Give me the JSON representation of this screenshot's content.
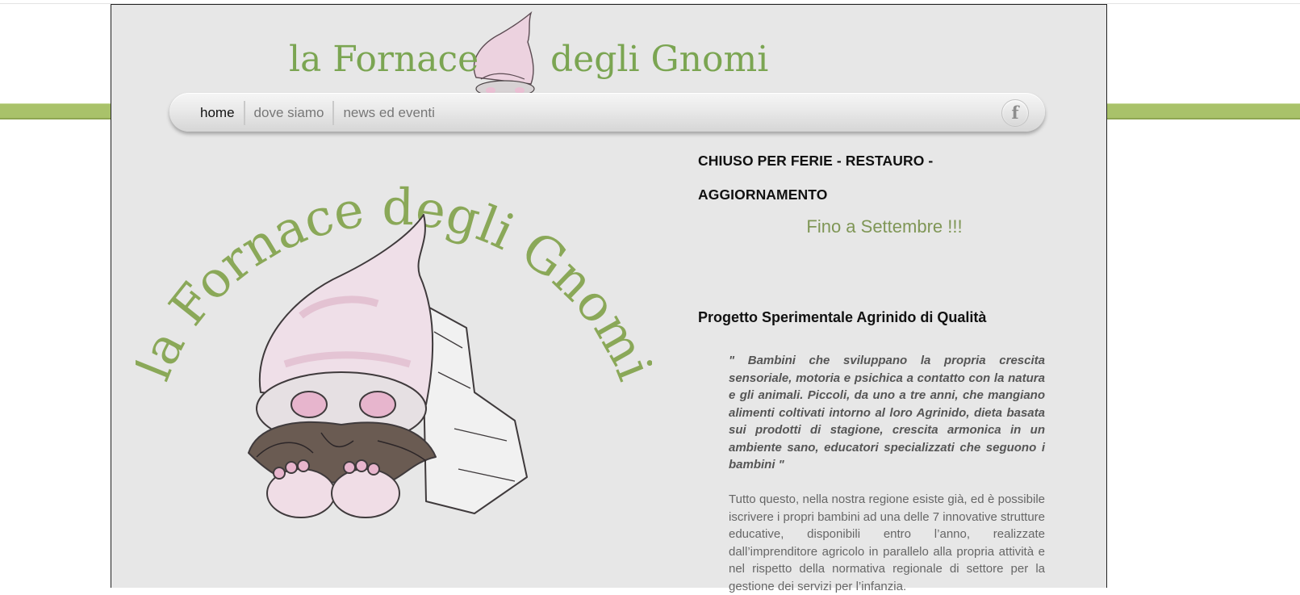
{
  "site": {
    "logo_left": "la Fornace",
    "logo_right": "degli Gnomi",
    "art_text": "la Fornace degli Gnomi"
  },
  "nav": {
    "items": [
      {
        "label": "home"
      },
      {
        "label": "dove siamo"
      },
      {
        "label": "news ed eventi"
      }
    ],
    "social_glyph": "f",
    "social_icon": "facebook-icon"
  },
  "notice": {
    "title_line1": "CHIUSO PER FERIE - RESTAURO -",
    "title_line2": "AGGIORNAMENTO",
    "subtitle": "Fino a Settembre !!!"
  },
  "project": {
    "title": "Progetto Sperimentale Agrinido di Qualità",
    "quote": "\" Bambini che sviluppano la propria crescita sensoriale, motoria e psichica a contatto con la natura e gli animali. Piccoli, da uno a tre anni, che mangiano alimenti coltivati intorno al loro Agrinido, dieta basata sui prodotti di stagione, crescita armonica in un ambiente sano, educatori specializzati che seguono i bambini \"",
    "paragraph": "Tutto questo, nella nostra regione esiste già, ed è possibile iscrivere i propri bambini ad una delle 7 innovative strutture educative, disponibili entro l’anno, realizzate dall’imprenditore agricolo in parallelo alla propria attività e nel rispetto della normativa regionale di settore per la gestione dei servizi per l’infanzia."
  },
  "colors": {
    "accent_green": "#8aa858",
    "bar_green": "#a9c26a",
    "gnome_pink": "#e8c6d6",
    "page_bg": "#e7e7e7"
  }
}
